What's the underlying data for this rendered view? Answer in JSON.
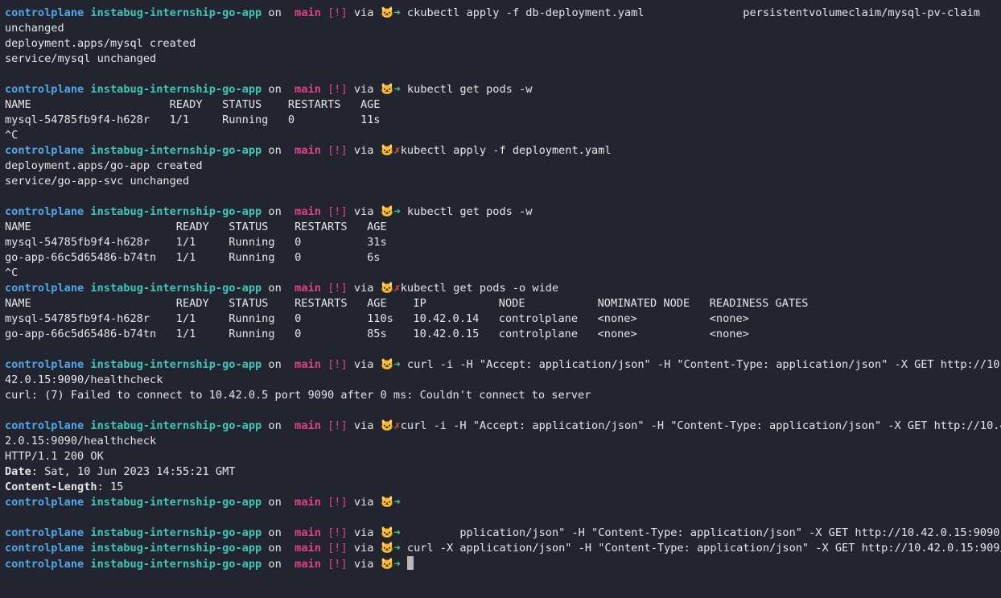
{
  "terminal": {
    "prompt": {
      "host": "controlplane",
      "repo": "instabug-internship-go-app",
      "on": "on",
      "branch_icon": "",
      "branch": "main",
      "status": "[!]",
      "via": "via",
      "arrow_ok": "🐱➜",
      "arrow_err": "🐱✗"
    },
    "lines": [
      {
        "type": "prompt",
        "ok": true,
        "cmd": " ckubectl apply -f db-deployment.yaml               persistentvolumeclaim/mysql-pv-claim"
      },
      {
        "type": "out",
        "text": "unchanged"
      },
      {
        "type": "out",
        "text": "deployment.apps/mysql created"
      },
      {
        "type": "out",
        "text": "service/mysql unchanged"
      },
      {
        "type": "out",
        "text": ""
      },
      {
        "type": "prompt",
        "ok": true,
        "cmd": " kubectl get pods -w"
      },
      {
        "type": "out",
        "text": "NAME                     READY   STATUS    RESTARTS   AGE"
      },
      {
        "type": "out",
        "text": "mysql-54785fb9f4-h628r   1/1     Running   0          11s"
      },
      {
        "type": "out",
        "text": "^C"
      },
      {
        "type": "prompt",
        "ok": false,
        "cmd": "kubectl apply -f deployment.yaml"
      },
      {
        "type": "out",
        "text": "deployment.apps/go-app created"
      },
      {
        "type": "out",
        "text": "service/go-app-svc unchanged"
      },
      {
        "type": "out",
        "text": ""
      },
      {
        "type": "prompt",
        "ok": true,
        "cmd": " kubectl get pods -w"
      },
      {
        "type": "out",
        "text": "NAME                      READY   STATUS    RESTARTS   AGE"
      },
      {
        "type": "out",
        "text": "mysql-54785fb9f4-h628r    1/1     Running   0          31s"
      },
      {
        "type": "out",
        "text": "go-app-66c5d65486-b74tn   1/1     Running   0          6s"
      },
      {
        "type": "out",
        "text": "^C"
      },
      {
        "type": "prompt",
        "ok": false,
        "cmd": "kubectl get pods -o wide"
      },
      {
        "type": "out",
        "text": "NAME                      READY   STATUS    RESTARTS   AGE    IP           NODE           NOMINATED NODE   READINESS GATES"
      },
      {
        "type": "out",
        "text": "mysql-54785fb9f4-h628r    1/1     Running   0          110s   10.42.0.14   controlplane   <none>           <none>"
      },
      {
        "type": "out",
        "text": "go-app-66c5d65486-b74tn   1/1     Running   0          85s    10.42.0.15   controlplane   <none>           <none>"
      },
      {
        "type": "out",
        "text": ""
      },
      {
        "type": "prompt",
        "ok": true,
        "cmd": " curl -i -H \"Accept: application/json\" -H \"Content-Type: application/json\" -X GET http://10."
      },
      {
        "type": "out",
        "text": "42.0.15:9090/healthcheck"
      },
      {
        "type": "out",
        "text": "curl: (7) Failed to connect to 10.42.0.5 port 9090 after 0 ms: Couldn't connect to server"
      },
      {
        "type": "out",
        "text": ""
      },
      {
        "type": "prompt",
        "ok": false,
        "cmd": "curl -i -H \"Accept: application/json\" -H \"Content-Type: application/json\" -X GET http://10.4"
      },
      {
        "type": "out",
        "text": "2.0.15:9090/healthcheck"
      },
      {
        "type": "out",
        "text": "HTTP/1.1 200 OK"
      },
      {
        "type": "header",
        "key": "Date",
        "value": ": Sat, 10 Jun 2023 14:55:21 GMT"
      },
      {
        "type": "header",
        "key": "Content-Length",
        "value": ": 15"
      },
      {
        "type": "prompt",
        "ok": true,
        "cmd": ""
      },
      {
        "type": "out",
        "text": ""
      },
      {
        "type": "prompt",
        "ok": true,
        "cmd": "         pplication/json\" -H \"Content-Type: application/json\" -X GET http://10.42.0.15:9090"
      },
      {
        "type": "prompt",
        "ok": true,
        "cmd": " curl -X application/json\" -H \"Content-Type: application/json\" -X GET http://10.42.0.15:909/"
      },
      {
        "type": "prompt",
        "ok": true,
        "cmd": " ",
        "cursor": true
      }
    ]
  }
}
